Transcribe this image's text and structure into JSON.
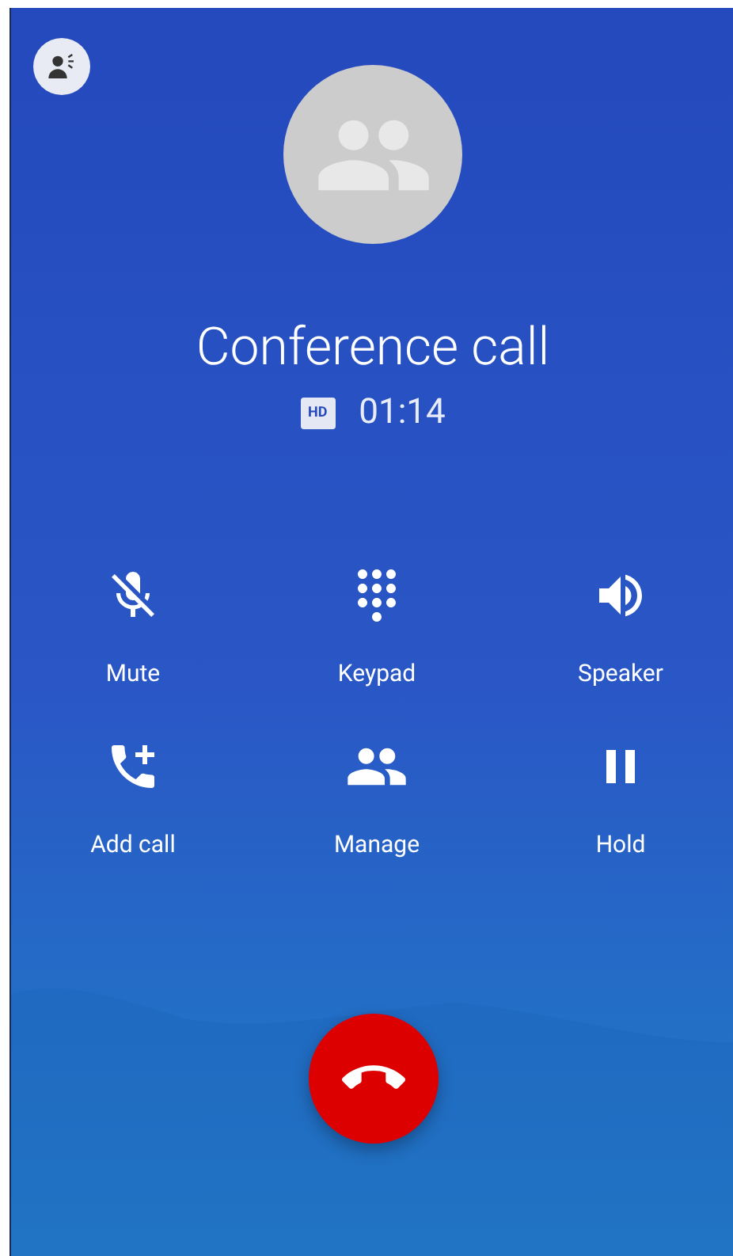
{
  "call": {
    "title": "Conference call",
    "hd_badge": "HD",
    "duration": "01:14"
  },
  "buttons": [
    {
      "kind": "mute",
      "label": "Mute"
    },
    {
      "kind": "keypad",
      "label": "Keypad"
    },
    {
      "kind": "speaker",
      "label": "Speaker"
    },
    {
      "kind": "add_call",
      "label": "Add call"
    },
    {
      "kind": "manage",
      "label": "Manage"
    },
    {
      "kind": "hold",
      "label": "Hold"
    }
  ]
}
